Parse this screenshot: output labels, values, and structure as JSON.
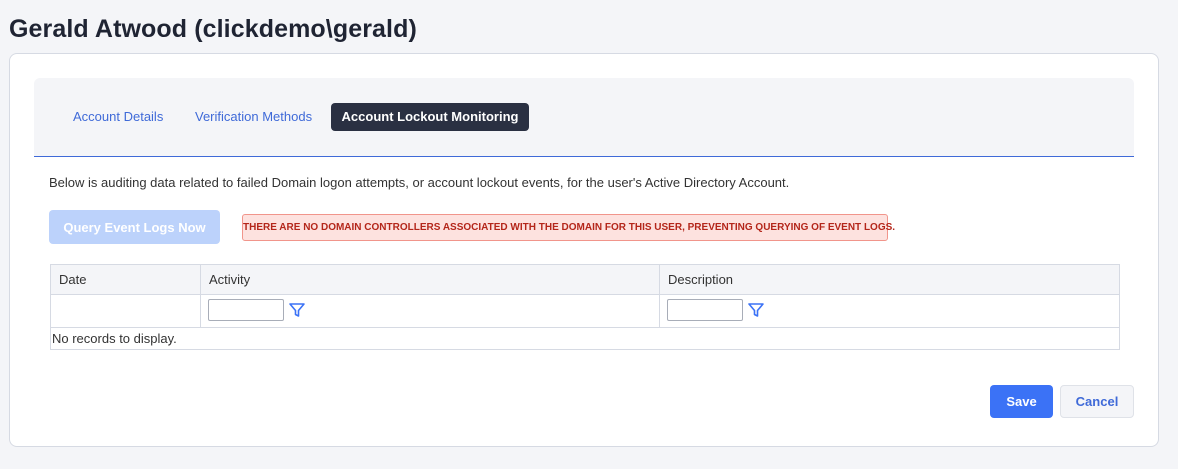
{
  "page": {
    "title": "Gerald Atwood (clickdemo\\gerald)"
  },
  "tabs": [
    {
      "label": "Account Details",
      "active": false
    },
    {
      "label": "Verification Methods",
      "active": false
    },
    {
      "label": "Account Lockout Monitoring",
      "active": true
    }
  ],
  "lockout": {
    "intro": "Below is auditing data related to failed Domain logon attempts, or account lockout events, for the user's Active Directory Account.",
    "query_button": "Query Event Logs Now",
    "alert": "THERE ARE NO DOMAIN CONTROLLERS ASSOCIATED WITH THE DOMAIN FOR THIS USER, PREVENTING QUERYING OF EVENT LOGS."
  },
  "grid": {
    "columns": [
      "Date",
      "Activity",
      "Description"
    ],
    "activity_filter": {
      "value": "",
      "icon": "filter-icon"
    },
    "description_filter": {
      "value": "",
      "icon": "filter-icon"
    },
    "empty_message": "No records to display."
  },
  "actions": {
    "save": "Save",
    "cancel": "Cancel"
  },
  "colors": {
    "accent": "#3f6ad8",
    "active_tab": "#2a3042",
    "save": "#3b72f6",
    "alert_text": "#b4261a",
    "alert_bg": "#fde2df"
  }
}
